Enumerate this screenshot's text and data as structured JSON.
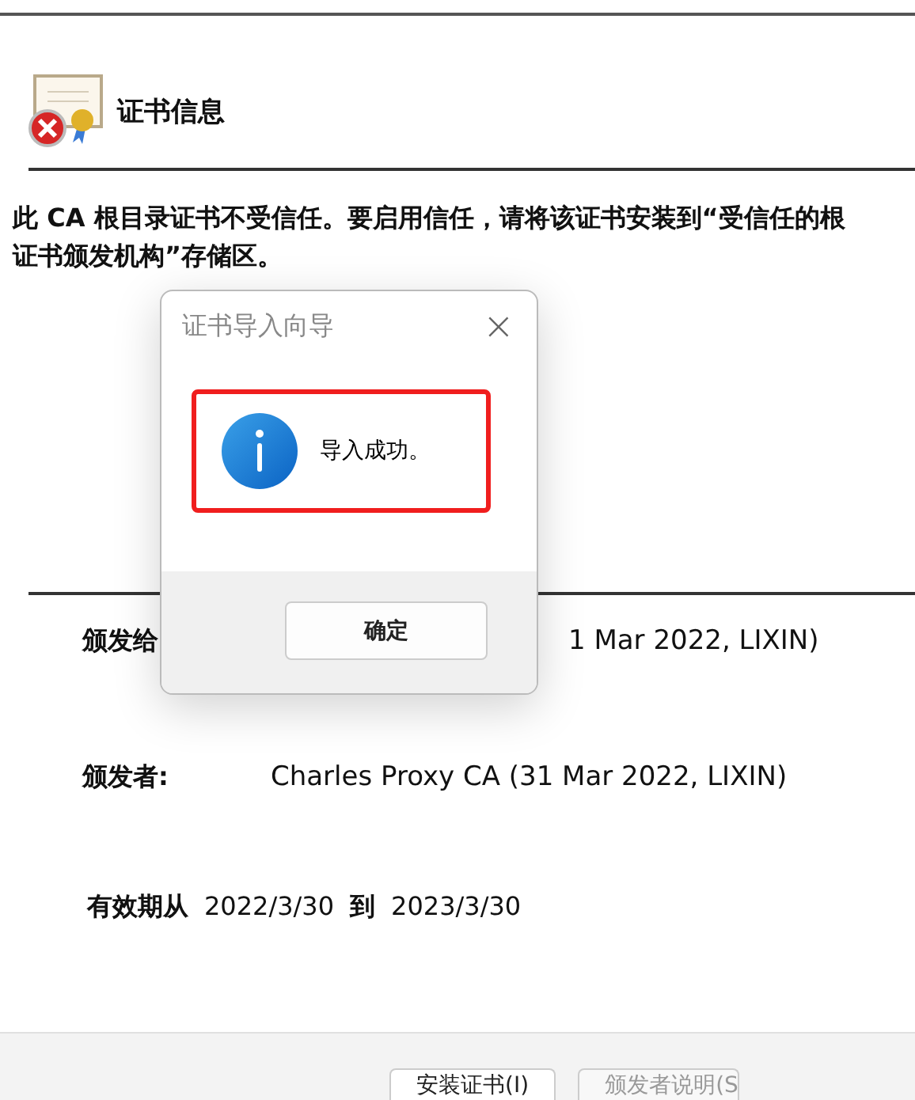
{
  "certificate": {
    "title": "证书信息",
    "notice": "此 CA 根目录证书不受信任。要启用信任，请将该证书安装到“受信任的根证书颁发机构”存储区。",
    "fields": [
      {
        "label": "颁发给",
        "value": "1 Mar 2022, LIXIN)",
        "covered": true
      },
      {
        "label": "颁发者:",
        "value": "Charles Proxy CA (31 Mar 2022, LIXIN)",
        "covered": false
      }
    ],
    "validity": {
      "label": "有效期从",
      "from": "2022/3/30",
      "to_word": "到",
      "to": "2023/3/30"
    },
    "buttons": [
      "安装证书(I)",
      "颁发者说明(S"
    ]
  },
  "dialog": {
    "title": "证书导入向导",
    "close": "×",
    "message": "导入成功。",
    "highlighted": true,
    "ok": "确定"
  }
}
